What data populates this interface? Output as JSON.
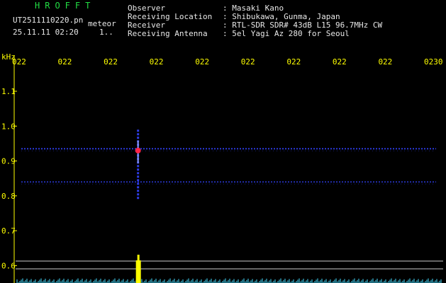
{
  "header": {
    "brand": "HROFFT",
    "filename": "UT2511110220.pn",
    "event_label": "meteor",
    "datetime": "25.11.11 02:20",
    "counter": "1..",
    "info_labels": [
      "Observer",
      "Receiving Location",
      "Receiver",
      "Receiving Antenna"
    ],
    "info_values": [
      ": Masaki Kano",
      ": Shibukawa, Gunma, Japan",
      ": RTL-SDR SDR# 43dB L15 96.7MHz CW",
      ": 5el Yagi Az 280 for Seoul"
    ]
  },
  "chart_data": {
    "type": "spectrogram",
    "unit_label": "kHz",
    "time_ticks": [
      "022",
      "022",
      "022",
      "022",
      "022",
      "022",
      "022",
      "022",
      "022",
      "0230"
    ],
    "freq_ticks": [
      "1.1",
      "1.0",
      "0.9",
      "0.8",
      "0.7",
      "0.6"
    ],
    "freq_range_khz": [
      0.57,
      1.16
    ],
    "carrier_lines_khz": [
      0.935,
      0.84
    ],
    "meteor_echo": {
      "time_tick_index": 3,
      "center_khz": 0.93,
      "span_khz": [
        0.79,
        0.99
      ]
    },
    "colors": {
      "axis": "#ffff00",
      "trace": "#3344ff",
      "echo": "#ff2244",
      "spectrum": "#44ddff",
      "peak": "#ffff00"
    }
  }
}
